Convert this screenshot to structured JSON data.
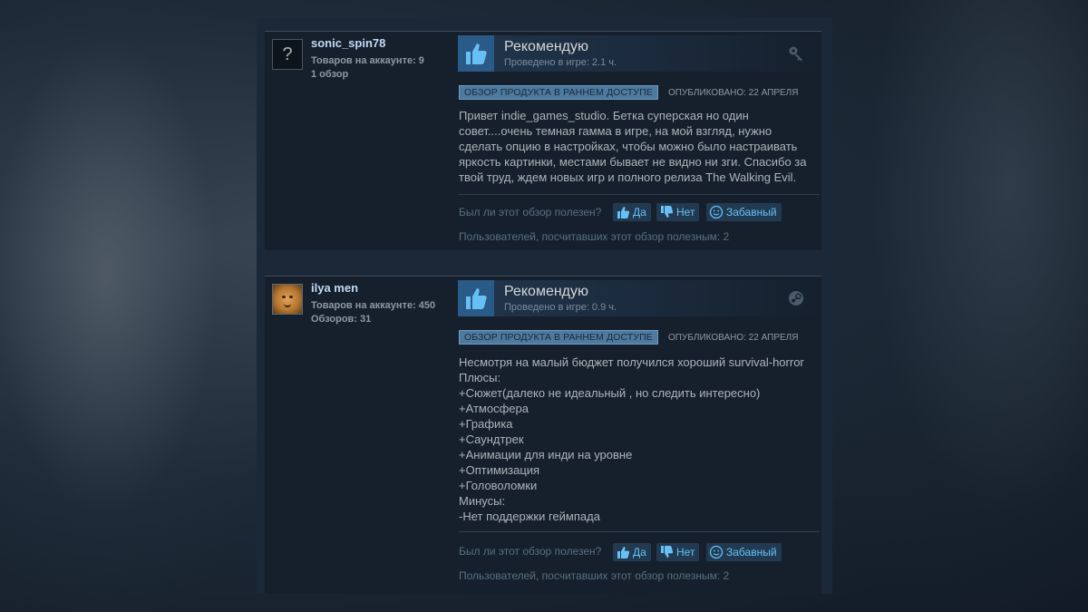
{
  "reviews": [
    {
      "user": {
        "name": "sonic_spin78",
        "products": "Товаров на аккаунте: 9",
        "reviews": "1 обзор",
        "avatar": "question-mark-avatar"
      },
      "recommendation": "Рекомендую",
      "hours": "Проведено в игре: 2.1 ч.",
      "product_icon": "key-icon",
      "badge": "ОБЗОР ПРОДУКТА В РАННЕМ ДОСТУПЕ",
      "posted": "ОПУБЛИКОВАНО: 22 АПРЕЛЯ",
      "text": "Привет indie_games_studio. Бетка суперская но один\nсовет....очень темная гамма в игре, на мой взгляд, нужно\nсделать опцию в настройках, чтобы можно было настраивать\nяркость картинки, местами бывает не видно ни зги. Спасибо за\nтвой труд, ждем новых игр и полного релиза The Walking Evil.",
      "helpful_question": "Был ли этот обзор полезен?",
      "yes": "Да",
      "no": "Нет",
      "funny": "Забавный",
      "helpful_count": "Пользователей, посчитавших этот обзор полезным: 2"
    },
    {
      "user": {
        "name": "ilya men",
        "products": "Товаров на аккаунте: 450",
        "reviews": "Обзоров: 31",
        "avatar": "smiley-face-avatar"
      },
      "recommendation": "Рекомендую",
      "hours": "Проведено в игре: 0.9 ч.",
      "product_icon": "steam-icon",
      "badge": "ОБЗОР ПРОДУКТА В РАННЕМ ДОСТУПЕ",
      "posted": "ОПУБЛИКОВАНО: 22 АПРЕЛЯ",
      "text": "Несмотря на малый бюджет получился хороший survival-horror\nПлюсы:\n+Сюжет(далеко не идеальный , но следить интересно)\n+Атмосфера\n+Графика\n+Саундтрек\n+Анимации для инди на уровне\n+Оптимизация\n+Головоломки\nМинусы:\n-Нет поддержки геймпада",
      "helpful_question": "Был ли этот обзор полезен?",
      "yes": "Да",
      "no": "Нет",
      "funny": "Забавный",
      "helpful_count": "Пользователей, посчитавших этот обзор полезным: 2"
    }
  ],
  "colors": {
    "panel": "#1b2838",
    "card": "#16202d",
    "accent": "#67c1f5",
    "badge": "#4d7a9e",
    "thumb": "#2a5a88"
  }
}
